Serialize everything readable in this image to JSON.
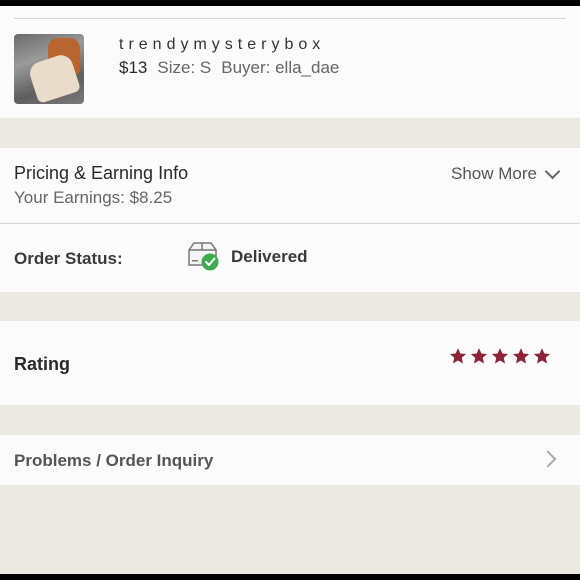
{
  "product": {
    "shop_name": "trendymysterybox",
    "price": "$13",
    "size": "Size: S",
    "buyer": "Buyer: ella_dae",
    "thumbnail_icon": "product-photo-beanies"
  },
  "pricing": {
    "title": "Pricing & Earning Info",
    "earnings": "Your Earnings: $8.25",
    "show_more": "Show More"
  },
  "order_status": {
    "label": "Order Status:",
    "value": "Delivered",
    "icon": "box-delivered-icon",
    "check_color": "#3daa4e"
  },
  "rating": {
    "label": "Rating",
    "stars": 5,
    "max_stars": 5,
    "star_color": "#8b2436"
  },
  "problems": {
    "label": "Problems / Order Inquiry"
  }
}
